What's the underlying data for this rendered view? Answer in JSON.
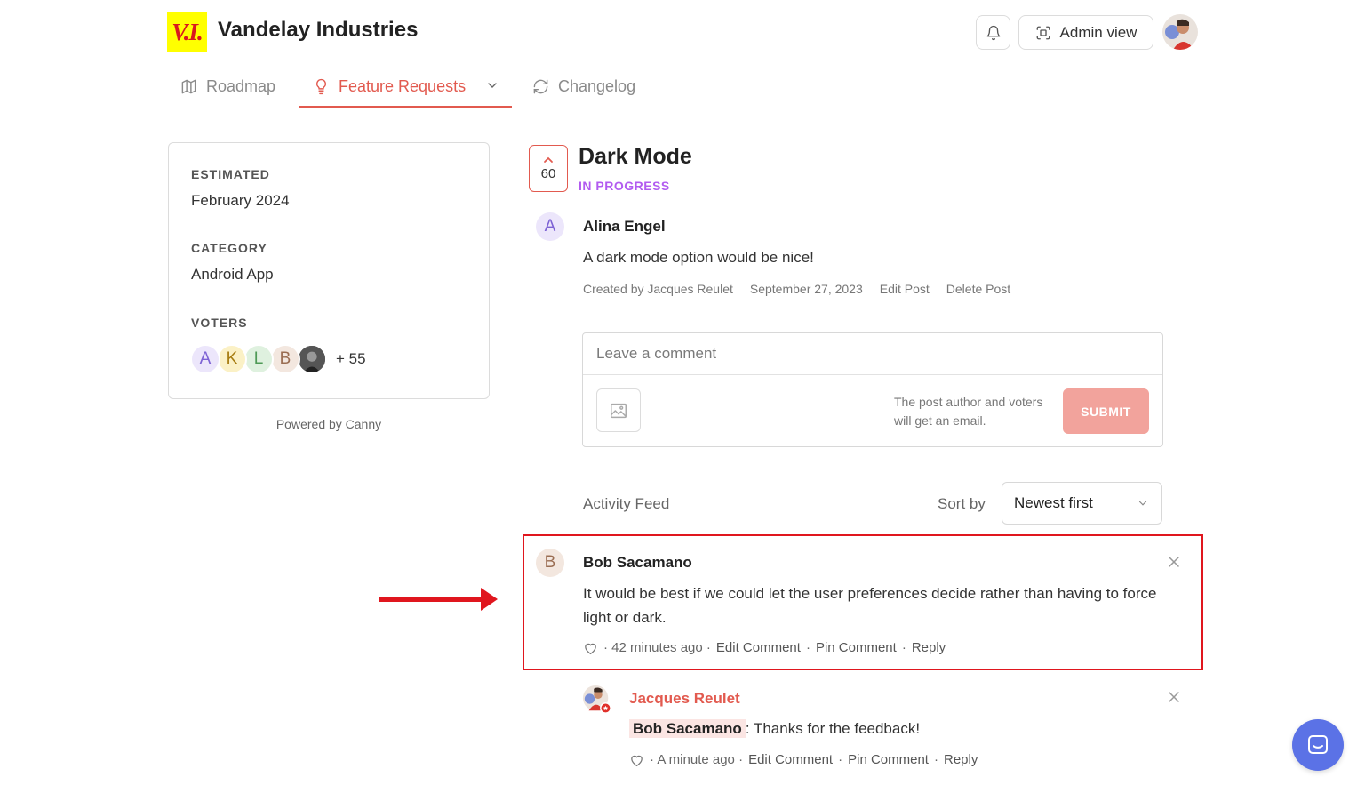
{
  "header": {
    "logo_text": "V.I.",
    "company_name": "Vandelay Industries",
    "admin_view_label": "Admin view"
  },
  "tabs": {
    "roadmap": "Roadmap",
    "feature_requests": "Feature Requests",
    "changelog": "Changelog"
  },
  "sidebar": {
    "estimated_label": "ESTIMATED",
    "estimated_value": "February 2024",
    "category_label": "CATEGORY",
    "category_value": "Android App",
    "voters_label": "VOTERS",
    "voter_initials": [
      "A",
      "K",
      "L",
      "B"
    ],
    "more_voters": "+ 55",
    "powered_by": "Powered by Canny"
  },
  "post": {
    "vote_count": "60",
    "title": "Dark Mode",
    "status": "IN PROGRESS",
    "author_initial": "A",
    "author_name": "Alina Engel",
    "body": "A dark mode option would be nice!",
    "created_by": "Created by Jacques Reulet",
    "date": "September 27, 2023",
    "edit_label": "Edit Post",
    "delete_label": "Delete Post"
  },
  "composer": {
    "placeholder": "Leave a comment",
    "note": "The post author and voters will get an email.",
    "submit_label": "SUBMIT"
  },
  "activity": {
    "label": "Activity Feed",
    "sort_label": "Sort by",
    "sort_value": "Newest first"
  },
  "comments": [
    {
      "initial": "B",
      "author": "Bob Sacamano",
      "body": "It would be best if we could let the user preferences decide rather than having to force light or dark.",
      "time": "· 42 minutes ago ·",
      "edit": "Edit Comment",
      "pin": "Pin Comment",
      "reply": "Reply"
    },
    {
      "author": "Jacques Reulet",
      "mention": "Bob Sacamano",
      "body": ": Thanks for the feedback!",
      "time": "· A minute ago ·",
      "edit": "Edit Comment",
      "pin": "Pin Comment",
      "reply": "Reply"
    }
  ],
  "colors": {
    "accent": "#e25a4f",
    "status_purple": "#b25bf0",
    "highlight_red": "#e0161e",
    "chat_blue": "#5b72e6"
  },
  "icons": [
    "bell-icon",
    "scan-icon",
    "map-icon",
    "lightbulb-icon",
    "chevron-down-icon",
    "refresh-icon",
    "image-icon",
    "heart-icon",
    "close-icon",
    "chat-icon",
    "arrow-icon"
  ]
}
